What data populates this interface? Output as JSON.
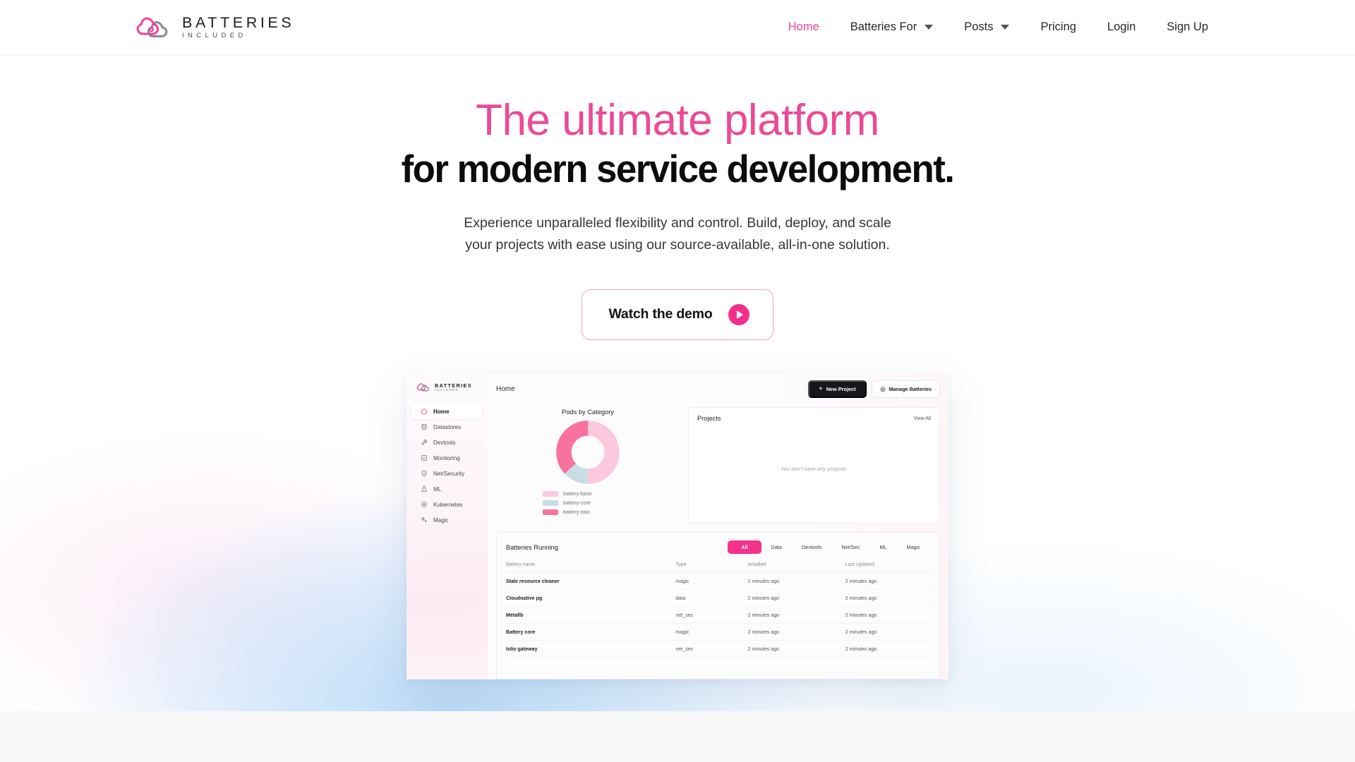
{
  "brand": {
    "name": "BATTERIES",
    "tagline": "INCLUDED",
    "accent": "#ec4899",
    "accent_dark": "#f2308a",
    "logo_icon": "double-cloud-icon"
  },
  "nav": {
    "items": [
      {
        "label": "Home",
        "active": true,
        "has_caret": false
      },
      {
        "label": "Batteries For",
        "active": false,
        "has_caret": true
      },
      {
        "label": "Posts",
        "active": false,
        "has_caret": true
      },
      {
        "label": "Pricing",
        "active": false,
        "has_caret": false
      },
      {
        "label": "Login",
        "active": false,
        "has_caret": false
      },
      {
        "label": "Sign Up",
        "active": false,
        "has_caret": false
      }
    ]
  },
  "hero": {
    "headline_line1": "The ultimate platform",
    "headline_line2": "for modern service development.",
    "subtitle_line1": "Experience unparalleled flexibility and control. Build, deploy, and scale",
    "subtitle_line2": "your projects with ease using our source-available, all-in-one solution.",
    "cta_label": "Watch the demo",
    "cta_icon": "play-circle-icon"
  },
  "dashboard": {
    "sidebar": {
      "brand_name": "BATTERIES",
      "brand_tagline": "INCLUDED",
      "items": [
        {
          "label": "Home",
          "icon": "home-icon",
          "active": true
        },
        {
          "label": "Datastores",
          "icon": "database-icon",
          "active": false
        },
        {
          "label": "Devtools",
          "icon": "wrench-icon",
          "active": false
        },
        {
          "label": "Monitoring",
          "icon": "chart-square-icon",
          "active": false
        },
        {
          "label": "Net/Security",
          "icon": "shield-check-icon",
          "active": false
        },
        {
          "label": "ML",
          "icon": "flask-icon",
          "active": false
        },
        {
          "label": "Kubernetes",
          "icon": "kubernetes-icon",
          "active": false
        },
        {
          "label": "Magic",
          "icon": "sparkles-icon",
          "active": false
        }
      ]
    },
    "breadcrumb": "Home",
    "actions": {
      "new_project": "New Project",
      "new_project_icon": "plus-icon",
      "manage_batteries": "Manage Batteries",
      "manage_batteries_icon": "gear-icon"
    },
    "projects_panel": {
      "title": "Projects",
      "view_all": "View All",
      "empty_message": "You don't have any projects."
    },
    "batteries_panel": {
      "title": "Batteries Running",
      "tabs": [
        {
          "label": "All",
          "active": true
        },
        {
          "label": "Data",
          "active": false
        },
        {
          "label": "Devtools",
          "active": false
        },
        {
          "label": "Net/Sec",
          "active": false
        },
        {
          "label": "ML",
          "active": false
        },
        {
          "label": "Magic",
          "active": false
        }
      ],
      "columns": [
        "Battery name",
        "Type",
        "Installed",
        "Last Updated"
      ],
      "rows": [
        {
          "name": "Stale resource cleaner",
          "type": "magic",
          "installed": "2 minutes ago",
          "updated": "2 minutes ago"
        },
        {
          "name": "Cloudnative pg",
          "type": "data",
          "installed": "2 minutes ago",
          "updated": "2 minutes ago"
        },
        {
          "name": "Metallb",
          "type": "net_sec",
          "installed": "2 minutes ago",
          "updated": "2 minutes ago"
        },
        {
          "name": "Battery core",
          "type": "magic",
          "installed": "2 minutes ago",
          "updated": "2 minutes ago"
        },
        {
          "name": "Istio gateway",
          "type": "net_sec",
          "installed": "2 minutes ago",
          "updated": "2 minutes ago"
        }
      ]
    }
  },
  "chart_data": {
    "type": "pie",
    "title": "Pods by Category",
    "labels": [
      "battery-base",
      "battery-core",
      "battery-istio"
    ],
    "values": [
      50,
      13,
      37
    ],
    "colors": [
      "#fbc9dd",
      "#c5dde3",
      "#f9719f"
    ],
    "donut": true,
    "legend_position": "bottom"
  }
}
